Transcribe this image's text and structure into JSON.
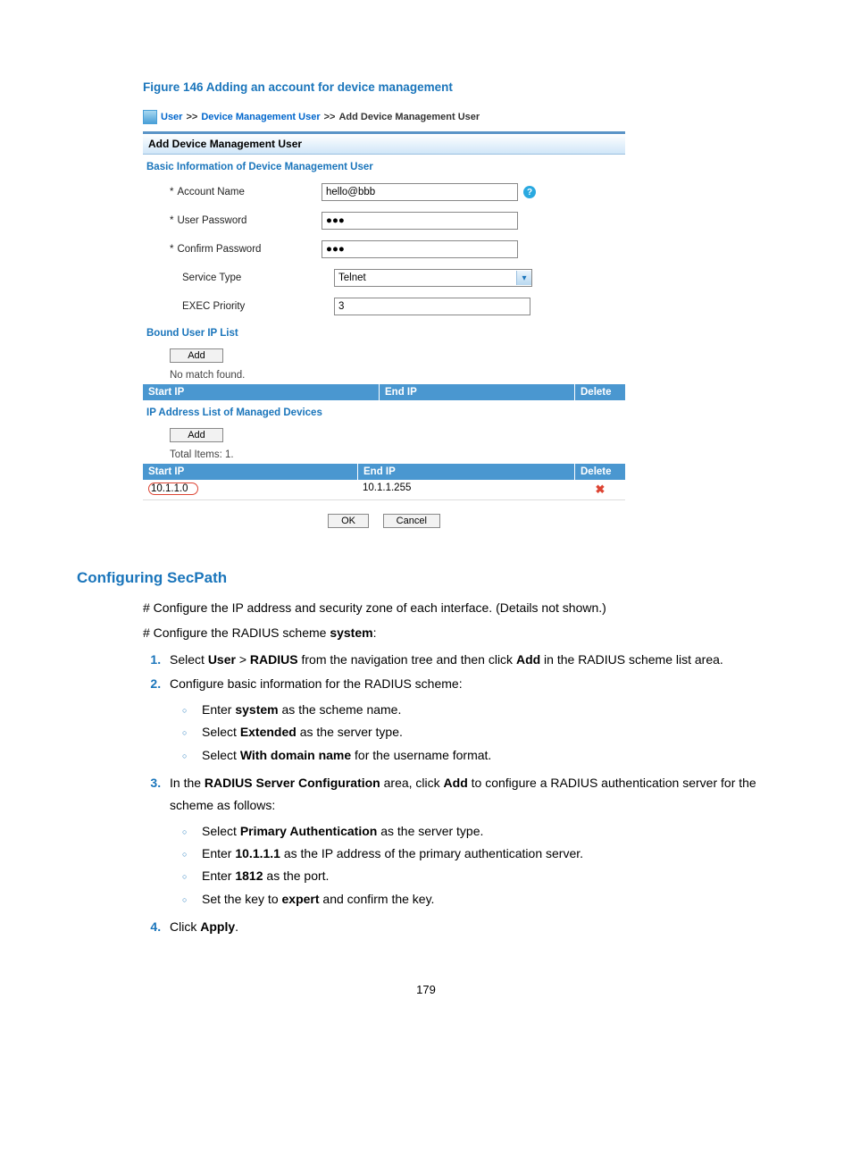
{
  "figure_title": "Figure 146 Adding an account for device management",
  "breadcrumb": {
    "item1": "User",
    "sep": ">>",
    "item2": "Device Management User",
    "item3": "Add Device Management User"
  },
  "panel_title": "Add Device Management User",
  "basic_info_title": "Basic Information of Device Management User",
  "fields": {
    "account_label": "Account Name",
    "account_value": "hello@bbb",
    "userpw_label": "User Password",
    "userpw_value": "●●●",
    "confirmpw_label": "Confirm Password",
    "confirmpw_value": "●●●",
    "service_label": "Service Type",
    "service_value": "Telnet",
    "exec_label": "EXEC Priority",
    "exec_value": "3"
  },
  "bound_ip_title": "Bound User IP List",
  "add_btn": "Add",
  "no_match": "No match found.",
  "cols": {
    "start": "Start IP",
    "end": "End IP",
    "delete": "Delete"
  },
  "managed_title": "IP Address List of Managed Devices",
  "total_items": "Total Items: 1.",
  "row1": {
    "start": "10.1.1.0",
    "end": "10.1.1.255"
  },
  "ok_btn": "OK",
  "cancel_btn": "Cancel",
  "doc": {
    "h2": "Configuring SecPath",
    "p1": "# Configure the IP address and security zone of each interface. (Details not shown.)",
    "p2_pre": "# Configure the RADIUS scheme ",
    "p2_b": "system",
    "p2_post": ":",
    "li1_a": "Select ",
    "li1_b1": "User",
    "li1_gt": " > ",
    "li1_b2": "RADIUS",
    "li1_c": " from the navigation tree and then click ",
    "li1_b3": "Add",
    "li1_d": " in the RADIUS scheme list area.",
    "li2": "Configure basic information for the RADIUS scheme:",
    "li2s1_a": "Enter ",
    "li2s1_b": "system",
    "li2s1_c": " as the scheme name.",
    "li2s2_a": "Select ",
    "li2s2_b": "Extended",
    "li2s2_c": " as the server type.",
    "li2s3_a": "Select ",
    "li2s3_b": "With domain name",
    "li2s3_c": " for the username format.",
    "li3_a": "In the ",
    "li3_b1": "RADIUS Server Configuration",
    "li3_c": " area, click ",
    "li3_b2": "Add",
    "li3_d": " to configure a RADIUS authentication server for the scheme as follows:",
    "li3s1_a": "Select ",
    "li3s1_b": "Primary Authentication",
    "li3s1_c": " as the server type.",
    "li3s2_a": "Enter ",
    "li3s2_b": "10.1.1.1",
    "li3s2_c": " as the IP address of the primary authentication server.",
    "li3s3_a": "Enter ",
    "li3s3_b": "1812",
    "li3s3_c": " as the port.",
    "li3s4_a": "Set the key to ",
    "li3s4_b": "expert",
    "li3s4_c": " and confirm the key.",
    "li4_a": "Click ",
    "li4_b": "Apply",
    "li4_c": "."
  },
  "page_number": "179"
}
